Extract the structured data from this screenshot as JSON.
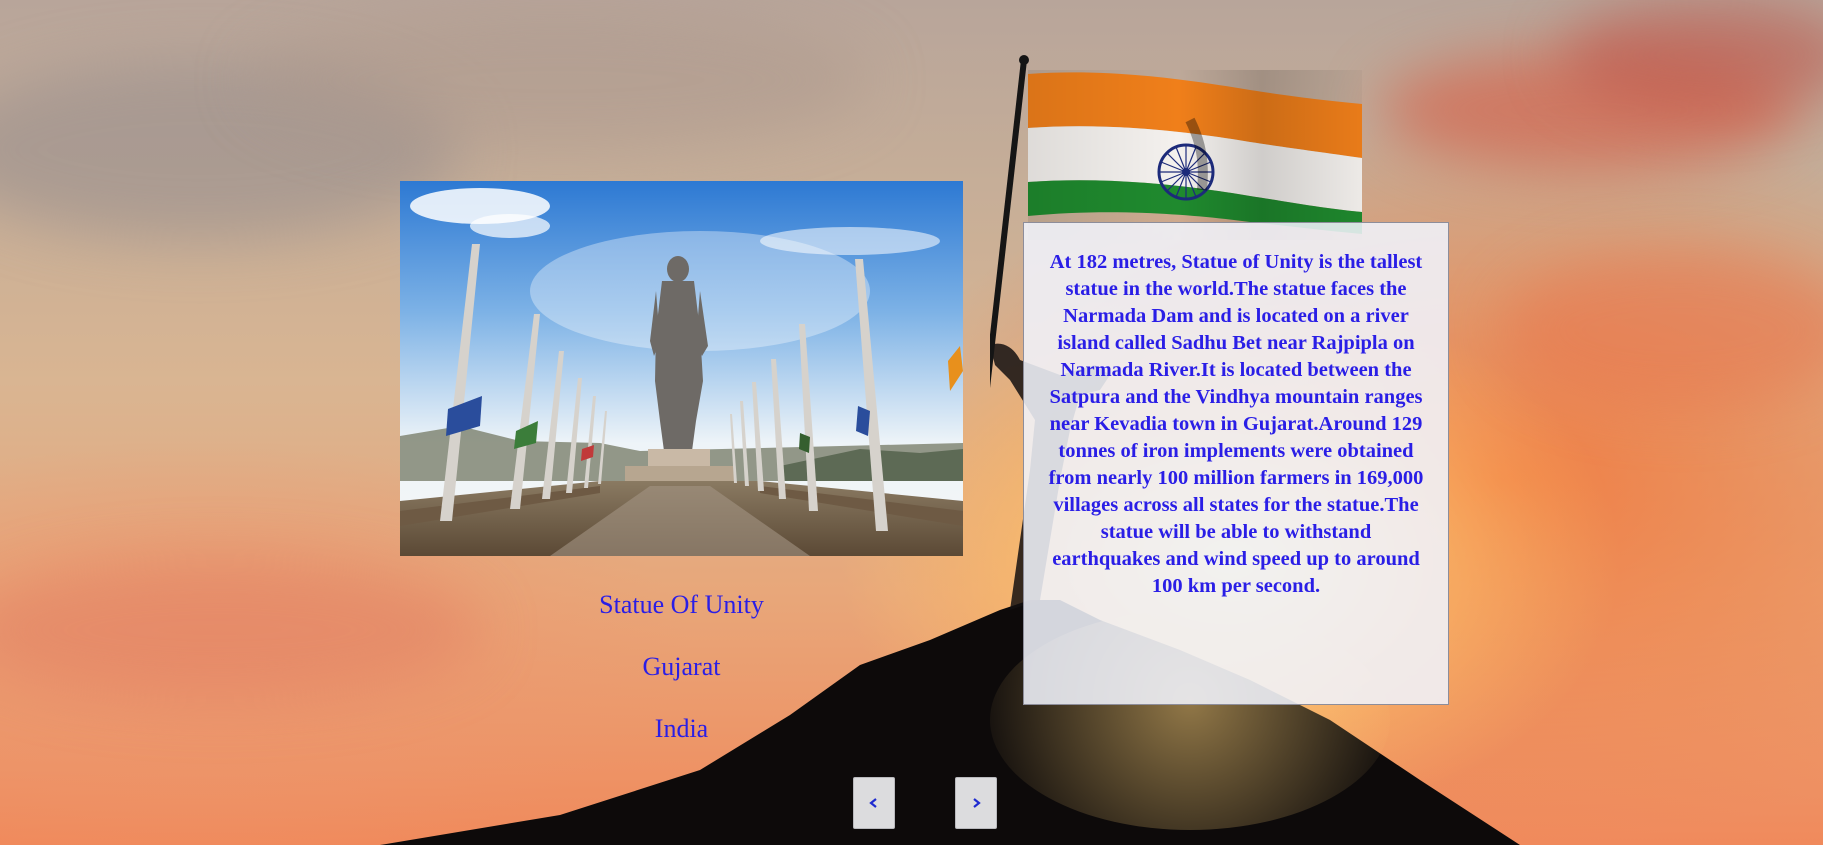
{
  "landmark": {
    "name": "Statue Of Unity",
    "state": "Gujarat",
    "country": "India",
    "image_icon": "statue-photo",
    "description": "At 182 metres, Statue of Unity is the tallest statue in the world.The statue faces the Narmada Dam and is located on a river island called Sadhu Bet near Rajpipla on Narmada River.It is located between the Satpura and the Vindhya mountain ranges near Kevadia town in Gujarat.Around 129 tonnes of iron implements were obtained from nearly 100 million farmers in 169,000 villages across all states for the statue.The statue will be able to withstand earthquakes and wind speed up to around 100 km per second."
  },
  "navigation": {
    "prev_icon": "chevron-left-icon",
    "next_icon": "chevron-right-icon"
  },
  "background": {
    "icon": "indian-flag-on-mountain",
    "colors": {
      "text_accent": "#2a1ee6",
      "saffron": "#f07f1a",
      "green": "#1f8a2e",
      "chakra": "#1c2a7a"
    }
  }
}
